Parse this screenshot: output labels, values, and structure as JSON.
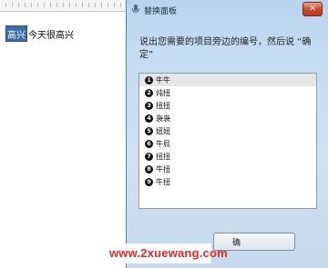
{
  "document": {
    "selected_text": "高兴",
    "rest_text": "今天很高兴"
  },
  "dialog": {
    "title": "替换面板",
    "close_label": "✕",
    "instruction": "说出您需要的项目旁边的编号，然后说 “确定”",
    "items": [
      {
        "num": "1",
        "text": "牛牛"
      },
      {
        "num": "2",
        "text": "炖扭"
      },
      {
        "num": "3",
        "text": "扭扭"
      },
      {
        "num": "4",
        "text": "袅袅"
      },
      {
        "num": "5",
        "text": "妞妞"
      },
      {
        "num": "6",
        "text": "牛屁"
      },
      {
        "num": "7",
        "text": "扭扭"
      },
      {
        "num": "8",
        "text": "牛扭"
      },
      {
        "num": "9",
        "text": "牛扭"
      }
    ],
    "button_label": "确"
  },
  "watermark": "www.2xuewang.com"
}
